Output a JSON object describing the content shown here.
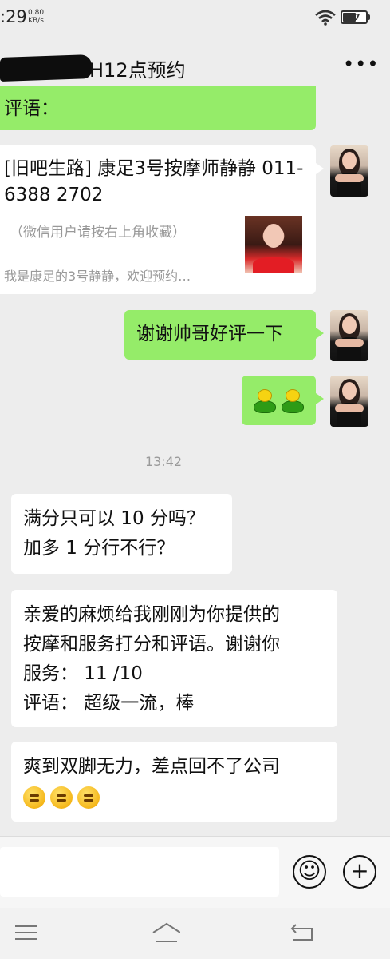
{
  "status_bar": {
    "time": ":29",
    "net_speed_value": "0.80",
    "net_speed_unit": "KB/s",
    "battery": "47",
    "icons": [
      "wifi-icon",
      "battery-icon"
    ]
  },
  "header": {
    "title": "H12点预约",
    "more_label": "•••",
    "icons": [
      "more-icon"
    ]
  },
  "messages": {
    "m1_text": "评语：",
    "link_card": {
      "title": "[旧吧生路] 康足3号按摩师静静 011-6388 2702",
      "note": "（微信用户请按右上角收藏）",
      "description": "我是康足的3号静静，欢迎预约…"
    },
    "m3_text": "谢谢帅哥好评一下",
    "timestamp": "13:42",
    "m5_line1": "满分只可以 10 分吗？",
    "m5_line2": "加多 1 分行不行？",
    "m6_line1": "亲爱的麻烦给我刚刚为你提供的",
    "m6_line2": "按摩和服务打分和评语。谢谢你",
    "m6_line3": "服务： 11 /10",
    "m6_line4": "评语： 超级一流，棒",
    "m7_line1": "爽到双脚无力，差点回不了公司"
  },
  "input_bar": {
    "emoji_button": "☺",
    "add_button": "+",
    "icons": [
      "emoji-icon",
      "plus-icon"
    ]
  },
  "nav_bar": {
    "icons": [
      "menu-icon",
      "home-icon",
      "back-icon"
    ]
  },
  "colors": {
    "background": "#ededed",
    "sent_bubble": "#95ec69",
    "received_bubble": "#ffffff",
    "timestamp": "#9a9a9a"
  }
}
